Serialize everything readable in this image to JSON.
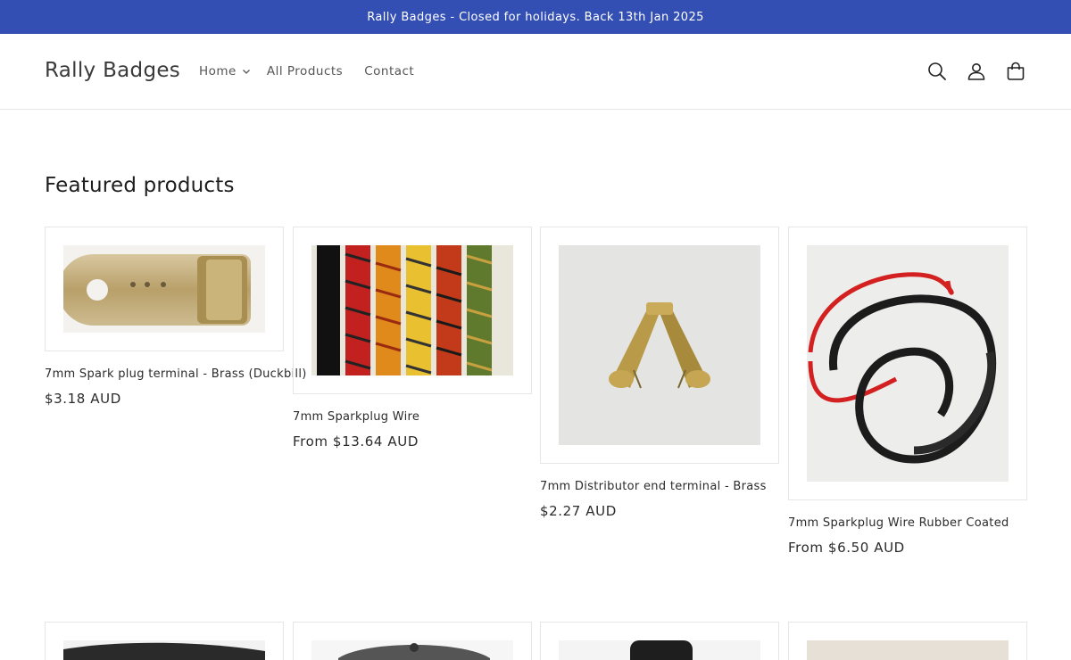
{
  "announcement": "Rally Badges - Closed for holidays. Back 13th Jan 2025",
  "header": {
    "logo": "Rally Badges",
    "nav": [
      {
        "label": "Home",
        "has_dropdown": true
      },
      {
        "label": "All Products",
        "has_dropdown": false
      },
      {
        "label": "Contact",
        "has_dropdown": false
      }
    ],
    "icons": [
      "search-icon",
      "account-icon",
      "cart-icon"
    ]
  },
  "featured": {
    "title": "Featured products",
    "products": [
      {
        "title": "7mm Spark plug terminal - Brass (Duckbill)",
        "price": "$3.18 AUD"
      },
      {
        "title": "7mm Sparkplug Wire",
        "price": "From $13.64 AUD"
      },
      {
        "title": "7mm Distributor end terminal - Brass",
        "price": "$2.27 AUD"
      },
      {
        "title": "7mm Sparkplug Wire Rubber Coated",
        "price": "From $6.50 AUD"
      }
    ]
  },
  "colors": {
    "announcement_bg": "#334fb4",
    "text": "#121212",
    "border": "#e6e6e6"
  }
}
